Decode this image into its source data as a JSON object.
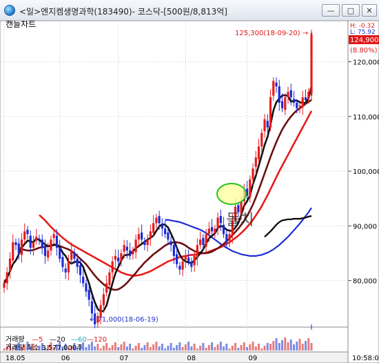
{
  "window": {
    "title": "<일>엔지켐생명과학(183490)- 코스닥-[500원/8,813억]",
    "minimize_label": "—",
    "restore_label": "□",
    "close_label": "✕"
  },
  "chart_data": {
    "type": "candlestick",
    "title": "캔들차트",
    "x_month_labels": [
      "18.05",
      "06",
      "07",
      "08",
      "09"
    ],
    "y_tick_labels": [
      "120,000",
      "110,000",
      "100,000",
      "90,000",
      "80,000"
    ],
    "ylim": [
      72000,
      127000
    ],
    "current_price": "124,900",
    "change_rate": "(8.80%)",
    "high_label": "H: -0.32",
    "low_label": "L: 75.92",
    "max_annotation": "125,300(18-09-20) →",
    "min_annotation": "← 71,000(18-06-19)",
    "overlay_text": "돌치",
    "moving_averages": [
      {
        "name": "ma5",
        "color": "#111111"
      },
      {
        "name": "ma20",
        "color": "#6b0f0f"
      },
      {
        "name": "ma60",
        "color": "#e81a1a"
      },
      {
        "name": "ma120",
        "color": "#1c2bd6"
      },
      {
        "name": "ma240",
        "color": "#000000"
      }
    ],
    "candles_close": [
      79500,
      81500,
      84000,
      87000,
      86500,
      85000,
      87500,
      89000,
      88500,
      86000,
      87000,
      88000,
      87500,
      86000,
      84500,
      85500,
      87500,
      88500,
      86000,
      84000,
      82500,
      81500,
      83500,
      85500,
      84000,
      82500,
      81000,
      79500,
      78000,
      76500,
      74000,
      72000,
      73500,
      75500,
      77500,
      79500,
      81500,
      83500,
      84500,
      83500,
      85000,
      86500,
      85500,
      84500,
      85500,
      87500,
      88500,
      87500,
      86500,
      87500,
      89000,
      90500,
      91500,
      90500,
      89500,
      88500,
      87500,
      86500,
      84500,
      83000,
      82000,
      83500,
      84500,
      83500,
      82500,
      84500,
      86500,
      87500,
      86500,
      88500,
      89500,
      89000,
      89500,
      91500,
      90500,
      88500,
      87000,
      88500,
      91000,
      93500,
      92500,
      94500,
      96500,
      95500,
      98500,
      100500,
      102500,
      104500,
      107000,
      109500,
      108000,
      113500,
      116500,
      115500,
      112500,
      111500,
      113500,
      114500,
      113500,
      112500,
      111500,
      112000,
      113500,
      113000,
      114500,
      124900
    ],
    "ma5": [
      79500,
      80500,
      81700,
      83000,
      83700,
      84800,
      86000,
      86700,
      87300,
      87200,
      87000,
      87700,
      87400,
      87000,
      86600,
      86300,
      86300,
      86600,
      86500,
      86100,
      85100,
      84500,
      83500,
      83100,
      83400,
      83500,
      83300,
      82500,
      81000,
      79500,
      77600,
      76000,
      74800,
      74300,
      74500,
      75500,
      77500,
      79500,
      81300,
      82500,
      83600,
      84600,
      84700,
      84800,
      85400,
      85900,
      86300,
      86700,
      87100,
      87500,
      87800,
      88200,
      89100,
      89900,
      90300,
      90200,
      89700,
      88600,
      87400,
      86000,
      84700,
      83900,
      83500,
      83300,
      83200,
      83700,
      84300,
      85000,
      85700,
      86800,
      87700,
      88200,
      88600,
      89600,
      90000,
      89800,
      89300,
      89100,
      89100,
      89700,
      90500,
      92000,
      93700,
      94500,
      95600,
      97600,
      99200,
      101000,
      102900,
      104800,
      106300,
      108500,
      111100,
      112600,
      113300,
      113800,
      113900,
      113700,
      112700,
      112900,
      112900,
      112600,
      112500,
      112500,
      113300,
      115600
    ],
    "ma20": [
      86000,
      85800,
      85600,
      85500,
      85500,
      85600,
      85800,
      86000,
      86100,
      86200,
      86300,
      86400,
      86500,
      86500,
      86300,
      86100,
      85900,
      85700,
      85400,
      85000,
      84500,
      84000,
      83500,
      83000,
      82300,
      81600,
      80900,
      80300,
      79800,
      79300,
      78900,
      78600,
      78400,
      78300,
      78400,
      78700,
      79100,
      79600,
      80200,
      80800,
      81400,
      82100,
      82700,
      83300,
      83800,
      84300,
      84800,
      85200,
      85600,
      86000,
      86400,
      86700,
      86900,
      87000,
      87000,
      86900,
      86700,
      86400,
      86000,
      85700,
      85400,
      85200,
      85100,
      85000,
      85000,
      85100,
      85300,
      85600,
      85900,
      86300,
      86700,
      87200,
      87700,
      88300,
      88900,
      89500,
      90200,
      90900,
      91800,
      92800,
      93900,
      95200,
      96600,
      98100,
      99600,
      101100,
      102600,
      104000,
      105300,
      106500,
      107600,
      108500,
      109300,
      110000,
      110600,
      111100,
      111500,
      111900,
      112300,
      112700,
      113000
    ],
    "ma60": [
      92000,
      91500,
      91000,
      90400,
      89800,
      89300,
      88800,
      88300,
      87800,
      87400,
      87000,
      86600,
      86300,
      86000,
      85700,
      85400,
      85100,
      84800,
      84500,
      84200,
      83900,
      83600,
      83300,
      83000,
      82700,
      82400,
      82100,
      81800,
      81500,
      81300,
      81100,
      81000,
      80900,
      80900,
      81000,
      81100,
      81300,
      81500,
      81700,
      82000,
      82300,
      82600,
      82900,
      83200,
      83500,
      83700,
      83900,
      84100,
      84300,
      84400,
      84500,
      84600,
      84700,
      84700,
      84800,
      84900,
      85000,
      85100,
      85300,
      85500,
      85700,
      85900,
      86100,
      86400,
      86700,
      87000,
      87400,
      87800,
      88200,
      88700,
      89200,
      89800,
      90400,
      91100,
      91900,
      92700,
      93600,
      94600,
      95600,
      96700,
      97800,
      98900,
      100000,
      101000,
      102000,
      103000,
      104000,
      105000,
      106000,
      107000,
      108000,
      109000,
      110000,
      111000
    ],
    "ma120": [
      91100,
      91100,
      91000,
      90900,
      90800,
      90700,
      90500,
      90300,
      90100,
      89900,
      89700,
      89500,
      89300,
      89000,
      88700,
      88300,
      87900,
      87500,
      87100,
      86700,
      86300,
      86000,
      85700,
      85400,
      85200,
      85000,
      84800,
      84700,
      84600,
      84500,
      84500,
      84500,
      84600,
      84700,
      84900,
      85100,
      85400,
      85700,
      86100,
      86500,
      87000,
      87500,
      88000,
      88600,
      89200,
      89800,
      90400,
      91100,
      91800,
      92500,
      93300
    ],
    "ma240": [
      88000,
      88500,
      89000,
      89600,
      90200,
      90700,
      91000,
      91100,
      91200,
      91200,
      91300,
      91300,
      91300,
      91400,
      91500,
      91700,
      91800
    ],
    "volume_legend": [
      "거래량",
      "—5",
      "—20",
      "—60",
      "—120"
    ],
    "volume_label": "거래량 최소 3,577,000주",
    "time_label": "10:58:03"
  }
}
